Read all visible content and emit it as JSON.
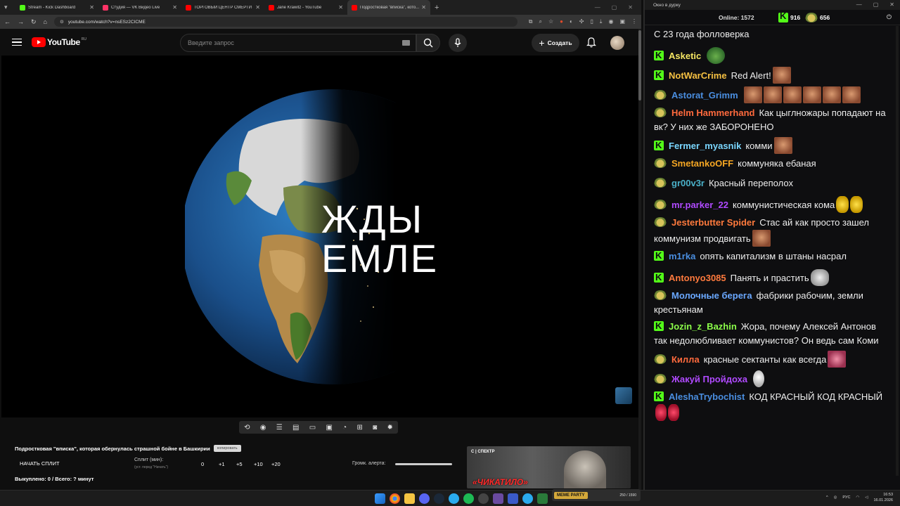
{
  "browser": {
    "tabs": [
      {
        "title": "Stream - Kick Dashboard",
        "color": "#53fc18"
      },
      {
        "title": "Студия — VK Видео Live",
        "color": "#ff3366"
      },
      {
        "title": "ТОРГОВЫЙ ЦЕНТР СМЕРТИ - ...",
        "color": "#ff0000"
      },
      {
        "title": "Jane Krawitz - YouTube",
        "color": "#ff0000"
      },
      {
        "title": "Подростковая \"вписка\", кото...",
        "color": "#ff0000"
      }
    ],
    "url": "youtube.com/watch?v=nsESz2CICME"
  },
  "youtube": {
    "logo_text": "YouTube",
    "region": "RU",
    "search_placeholder": "Введите запрос",
    "create_label": "Создать"
  },
  "video": {
    "overlay_line1": "ЖДЫ",
    "overlay_line2": "ЕМЛЕ"
  },
  "below_video": {
    "title": "Подростковая \"вписка\", которая обернулась страшной бойне в Башкирии",
    "pill": "копировать",
    "split_start": "НАЧАТЬ СПЛИТ",
    "split_label": "Сплит (мин):",
    "split_sub": "(уст. перед \"Начать\")",
    "split_values": [
      "0",
      "+1",
      "+5",
      "+10",
      "+20"
    ],
    "alert_label": "Громк. алерта:",
    "bought": "Выкуплено: 0 / Всего: ? минут",
    "ad_brand": "С | СПЕКТР",
    "ad_text": "«ЧИКАТИЛО»"
  },
  "chat": {
    "window_title": "Окно в дурку",
    "online_label": "Online:",
    "online_count": "1572",
    "kick_count": "916",
    "pepe_count": "656",
    "messages": [
      {
        "badge": "none",
        "user": "",
        "color": "#ffffff",
        "text": "С 23 года фолловерка",
        "emotes": []
      },
      {
        "badge": "kick",
        "user": "Asketic",
        "color": "#f5e663",
        "text": "",
        "emotes": [
          "frog"
        ]
      },
      {
        "badge": "kick",
        "user": "NotWarCrime",
        "color": "#f5c042",
        "text": "Red Alert!",
        "emotes": [
          "face"
        ]
      },
      {
        "badge": "pepe",
        "user": "Astorat_Grimm",
        "color": "#4a8ee0",
        "text": "",
        "emotes": [
          "face",
          "face",
          "face",
          "face",
          "face",
          "face"
        ]
      },
      {
        "badge": "pepe",
        "user": "Helm Hammerhand",
        "color": "#ff6a3d",
        "text": "Как цыглножары попадают на вк? У них же ЗАБОРОНЕНО",
        "emotes": []
      },
      {
        "badge": "kick",
        "user": "Fermer_myasnik",
        "color": "#7ad7ff",
        "text": "комми",
        "emotes": [
          "face"
        ]
      },
      {
        "badge": "pepe",
        "user": "SmetankoOFF",
        "color": "#f5a623",
        "text": "коммуняка ебаная",
        "emotes": []
      },
      {
        "badge": "pepe",
        "user": "gr00v3r",
        "color": "#4ab0c8",
        "text": "Красный переполох",
        "emotes": []
      },
      {
        "badge": "pepe",
        "user": "mr.parker_22",
        "color": "#b04aff",
        "text": "коммунистическая кома",
        "emotes": [
          "yellow",
          "yellow"
        ]
      },
      {
        "badge": "pepe",
        "user": "Jesterbutter Spider",
        "color": "#ff7a3d",
        "text": "Стас ай как просто зашел коммунизм продвигать",
        "emotes": [
          "face"
        ]
      },
      {
        "badge": "kick",
        "user": "m1rka",
        "color": "#4a8ee0",
        "text": "опять капитализм в штаны насрал",
        "emotes": []
      },
      {
        "badge": "kick",
        "user": "Antonyo3085",
        "color": "#ff7a3d",
        "text": "Панять и прастить",
        "emotes": [
          "cat"
        ]
      },
      {
        "badge": "pepe",
        "user": "Молочные берега",
        "color": "#6aa8ff",
        "text": "фабрики рабочим, земли крестьянам",
        "emotes": []
      },
      {
        "badge": "kick",
        "user": "Jozin_z_Bazhin",
        "color": "#8cff4a",
        "text": "Жора, почему Алексей Антонов так недолюбливает коммунистов? Он ведь сам Коми",
        "emotes": []
      },
      {
        "badge": "pepe",
        "user": "Килла",
        "color": "#ff6a3d",
        "text": "красные сектанты как всегда",
        "emotes": [
          "pink"
        ]
      },
      {
        "badge": "pepe",
        "user": "Жакуй Пройдоха",
        "color": "#b04aff",
        "text": "",
        "emotes": [
          "snow"
        ]
      },
      {
        "badge": "kick",
        "user": "AleshaTrybochist",
        "color": "#4a8ee0",
        "text": "КОД КРАСНЫЙ КОД КРАСНЫЙ",
        "emotes": [
          "red",
          "red"
        ]
      }
    ]
  },
  "taskbar": {
    "lang": "РУС",
    "time": "16:53",
    "date": "16.01.2026",
    "media_logo": "MEME PARTY",
    "media_progress": "250 / 1590"
  }
}
